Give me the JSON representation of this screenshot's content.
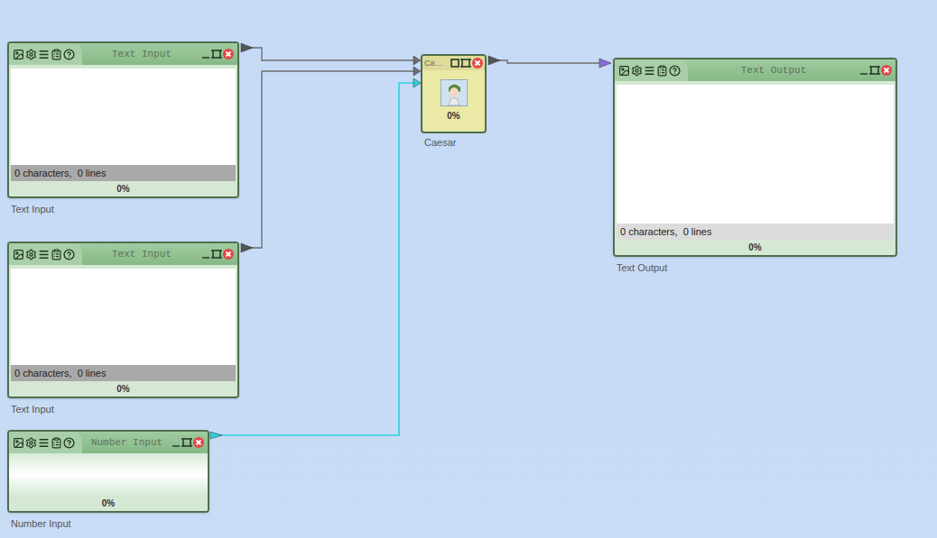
{
  "workspace": {
    "nodes": [
      {
        "kind": "text-input",
        "title": "Text Input",
        "label": "Text Input",
        "status": "0 characters,  0 lines",
        "progress": "0%",
        "level": 0
      },
      {
        "kind": "text-input",
        "title": "Text Input",
        "label": "Text Input",
        "status": "0 characters,  0 lines",
        "progress": "0%",
        "level": 0
      },
      {
        "kind": "number-input",
        "title": "Number Input",
        "label": "Number Input",
        "progress": "0%",
        "level": 0
      },
      {
        "kind": "plugin",
        "title": "Ca…",
        "label": "Caesar",
        "progress": "0%",
        "level": 0
      },
      {
        "kind": "text-output",
        "title": "Text Output",
        "label": "Text Output",
        "status": "0 characters,  0 lines",
        "progress": "0%",
        "level": 0
      }
    ],
    "connections": [
      {
        "color": "#6f6f6f"
      },
      {
        "color": "#6f6f6f"
      },
      {
        "color": "#2fd0e0"
      },
      {
        "color": "#6f6f6f"
      }
    ]
  }
}
